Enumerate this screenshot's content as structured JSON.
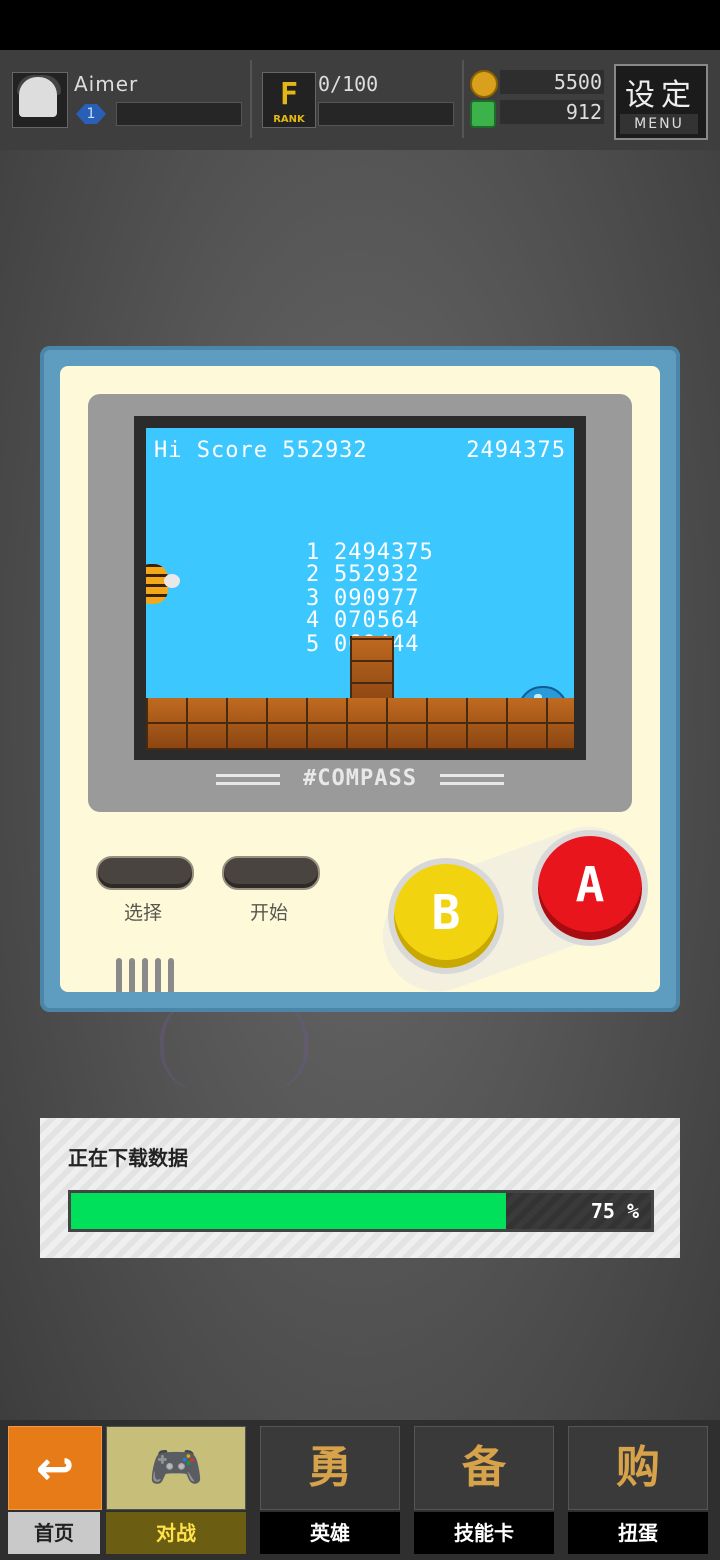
{
  "player": {
    "name": "Aimer",
    "level": "1"
  },
  "rank": {
    "label": "RANK",
    "progress": "0/100"
  },
  "currency": {
    "coins": "5500",
    "gems": "912"
  },
  "menu": {
    "title": "设定",
    "label": "MENU"
  },
  "game": {
    "hi_score_label": "Hi Score 552932",
    "current_score": "2494375",
    "leaderboard": [
      {
        "rank": "1",
        "score": "2494375"
      },
      {
        "rank": "2",
        "score": "552932"
      },
      {
        "rank": "3",
        "score": "090977"
      },
      {
        "rank": "4",
        "score": "070564"
      },
      {
        "rank": "5",
        "score": "060444"
      }
    ],
    "brand": "#COMPASS"
  },
  "controls": {
    "select_label": "选择",
    "start_label": "开始",
    "b_label": "B",
    "a_label": "A"
  },
  "download": {
    "title": "正在下载数据",
    "percent_text": "75 %",
    "progress": 0.75
  },
  "nav": {
    "home": {
      "label": "首页",
      "glyph": "↩"
    },
    "battle": {
      "label": "对战",
      "glyph": "🎮"
    },
    "heroes": {
      "label": "英雄",
      "glyph": "勇"
    },
    "cards": {
      "label": "技能卡",
      "glyph": "备"
    },
    "gacha": {
      "label": "扭蛋",
      "glyph": "购"
    }
  },
  "colors": {
    "accent_orange": "#e77b18",
    "progress_green": "#00e05a",
    "screen_blue": "#3cc7ff",
    "button_a": "#e8161c",
    "button_b": "#f1d40f"
  }
}
